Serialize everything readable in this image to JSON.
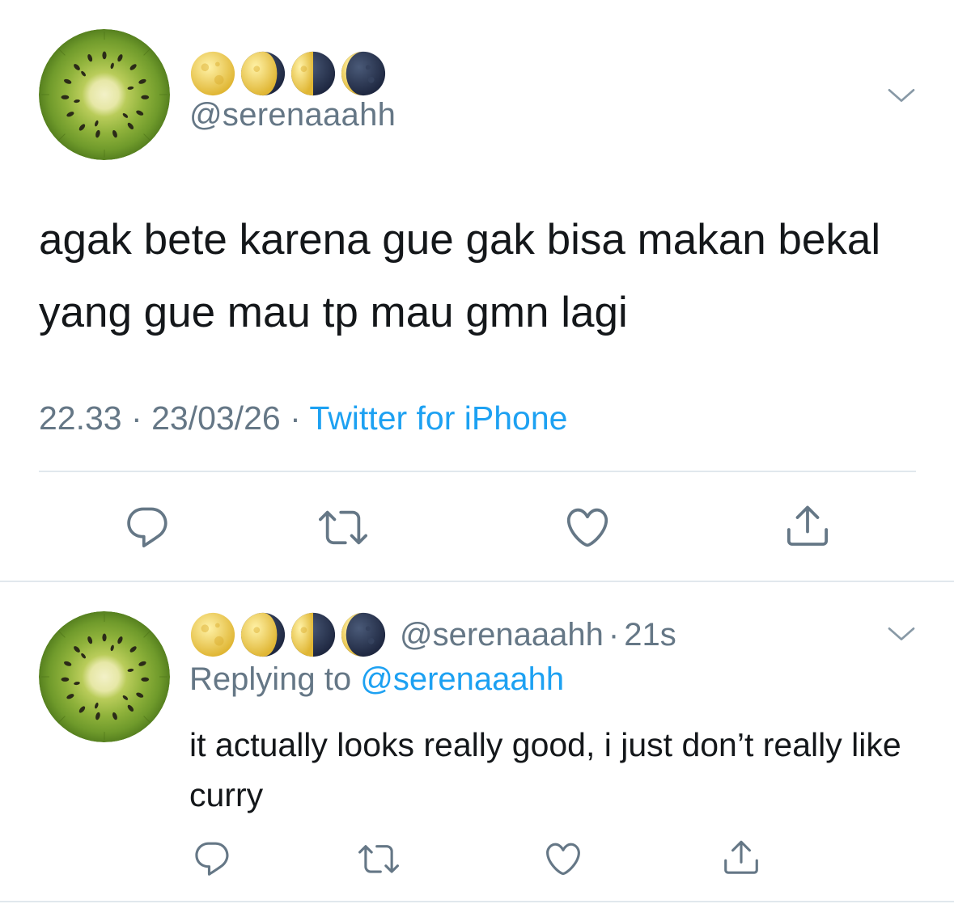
{
  "tweet": {
    "display_name_icons": [
      "full-moon-icon",
      "waning-gibbous-moon-icon",
      "last-quarter-moon-icon",
      "waning-crescent-moon-icon"
    ],
    "handle": "@serenaaahh",
    "text": "agak bete karena gue gak bisa makan bekal yang gue mau tp mau gmn lagi",
    "time": "22.33",
    "separator": "·",
    "date": "23/03/26",
    "source": "Twitter for iPhone"
  },
  "reply": {
    "display_name_icons": [
      "full-moon-icon",
      "waning-gibbous-moon-icon",
      "last-quarter-moon-icon",
      "waning-crescent-moon-icon"
    ],
    "handle": "@serenaaahh",
    "separator": "·",
    "age": "21s",
    "replying_prefix": "Replying to",
    "replying_handle": "@serenaaahh",
    "text": "it actually looks really good, i just don’t really like curry"
  },
  "actions": [
    "reply-icon",
    "retweet-icon",
    "like-icon",
    "share-icon"
  ],
  "colors": {
    "text": "#14171a",
    "secondary": "#657786",
    "link": "#1da1f2",
    "divider": "#e1e8ed",
    "avatar_kiwi": "#7ea733"
  }
}
